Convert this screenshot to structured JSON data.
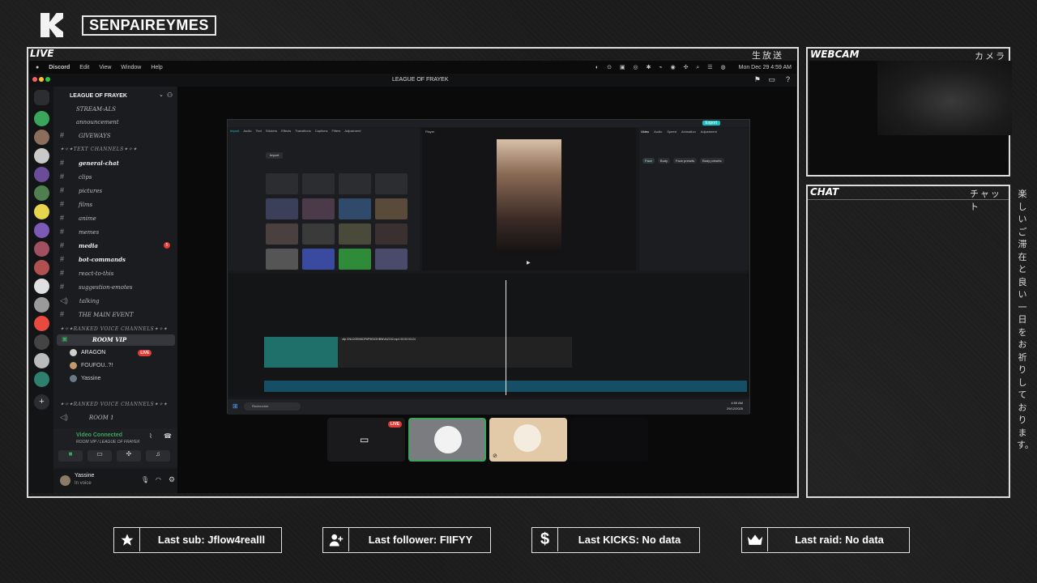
{
  "brand": {
    "name": "SENPAIREYMES"
  },
  "live_panel": {
    "label": "LIVE",
    "jp": "生放送"
  },
  "webcam_panel": {
    "label": "WEBCAM",
    "jp": "カメラ"
  },
  "chat_panel": {
    "label": "CHAT",
    "jp": "チャット"
  },
  "side_text": "楽しいご滞在と良い一日をお祈りしております。",
  "mac_menu": {
    "app": "Discord",
    "items": [
      "Edit",
      "View",
      "Window",
      "Help"
    ],
    "clock": "Mon Dec 29  4:59 AM"
  },
  "discord": {
    "window_title": "LEAGUE OF FRAYEK",
    "server_name": "LEAGUE OF FRAYEK",
    "top_channels": [
      {
        "label": "STREAM-ALS"
      },
      {
        "label": "announcement"
      },
      {
        "label": "GIVEWAYS"
      }
    ],
    "text_category": "✦✧✦TEXT CHANNELS✦✧✦",
    "text_channels": [
      {
        "label": "general-chat",
        "bold": true
      },
      {
        "label": "clips",
        "bold": false
      },
      {
        "label": "pictures",
        "bold": false
      },
      {
        "label": "films",
        "bold": false
      },
      {
        "label": "anime",
        "bold": false
      },
      {
        "label": "memes",
        "bold": false
      },
      {
        "label": "media",
        "bold": true,
        "badge": "5"
      },
      {
        "label": "bot-commands",
        "bold": true
      },
      {
        "label": "react-to-this",
        "bold": false
      },
      {
        "label": "suggestion-emotes",
        "bold": false
      },
      {
        "label": "talking",
        "bold": false
      },
      {
        "label": "THE MAIN EVENT",
        "bold": false
      }
    ],
    "voice_category": "✦✧✦RANKED VOICE CHANNELS✦✧✦",
    "voice_channel": "ROOM VIP",
    "voice_users": [
      {
        "name": "ARAGON",
        "live": "LIVE"
      },
      {
        "name": "FOUFOU..?!"
      },
      {
        "name": "Yassine"
      }
    ],
    "voice_category2": "✦✧✦RANKED VOICE CHANNELS✦✧✦",
    "voice_channel2": "ROOM 1",
    "voice_status": {
      "title": "Video Connected",
      "sub": "ROOM VIP / LEAGUE OF FRAYEK"
    },
    "user": {
      "name": "Yassine",
      "status": "In voice"
    },
    "participant_live": "LIVE"
  },
  "editor": {
    "tabs": [
      "Import",
      "Audio",
      "Text",
      "Stickers",
      "Effects",
      "Transitions",
      "Captions",
      "Filters",
      "Adjustment"
    ],
    "player_label": "Player",
    "prop_tabs": [
      "Video",
      "Audio",
      "Speed",
      "Animation",
      "Adjustment"
    ],
    "prop_chips": [
      "Face",
      "Body",
      "Face presets",
      "Body presets"
    ],
    "import_btn": "Import",
    "export_btn": "Export",
    "clip_name": "clip ENLDOBH6DP6P9K5OHBWVAZOI2.mp4  00:00:03:24",
    "taskbar_search": "Rechercher",
    "taskbar_time": "4:59 AM",
    "taskbar_date": "29/12/2025"
  },
  "widgets": [
    {
      "icon": "star-icon",
      "text": "Last sub: Jflow4realll"
    },
    {
      "icon": "user-plus-icon",
      "text": "Last follower: FIIFYY"
    },
    {
      "icon": "dollar-icon",
      "text": "Last KICKS: No data"
    },
    {
      "icon": "crown-icon",
      "text": "Last raid: No data"
    }
  ]
}
